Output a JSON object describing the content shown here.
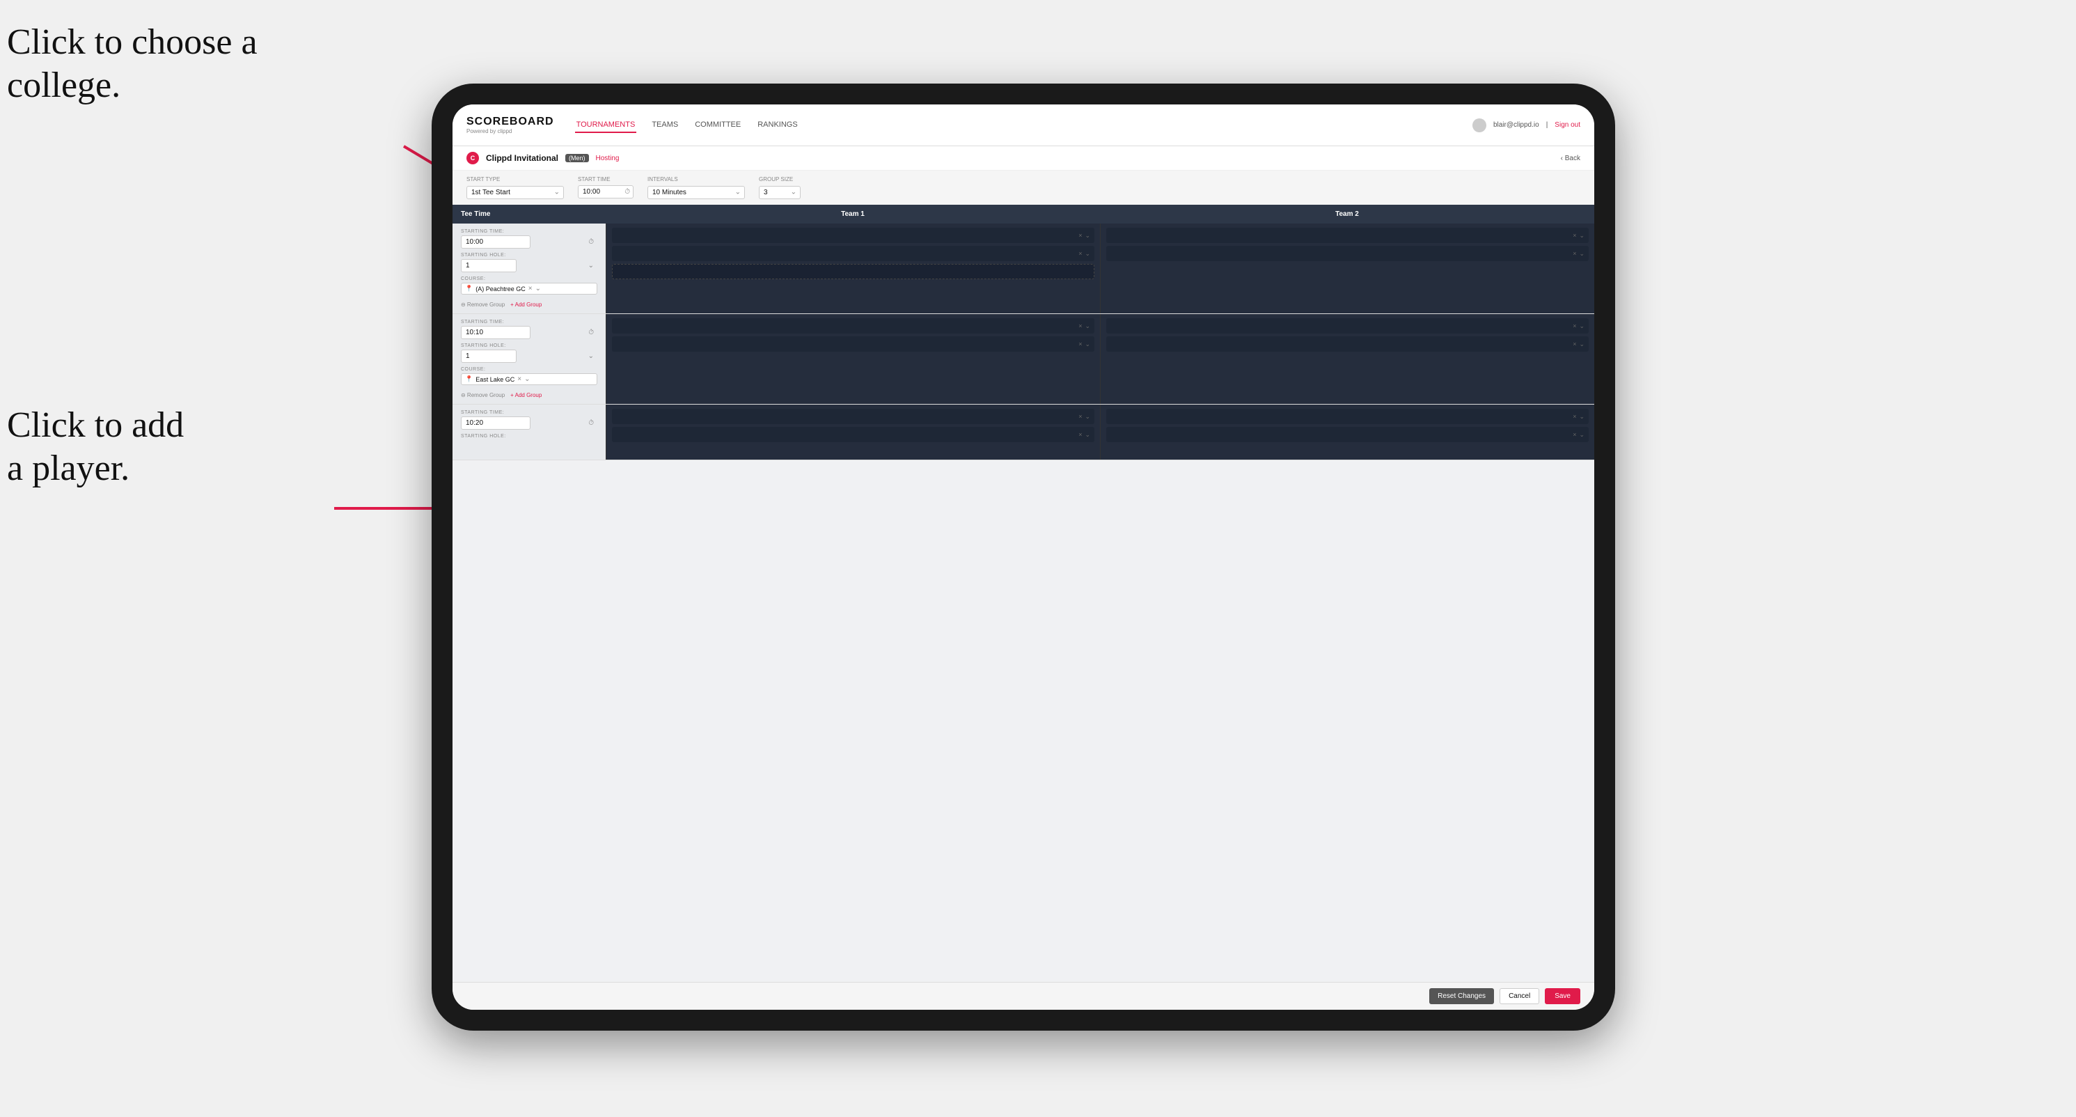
{
  "annotations": {
    "college_text_line1": "Click to choose a",
    "college_text_line2": "college.",
    "player_text_line1": "Click to add",
    "player_text_line2": "a player."
  },
  "nav": {
    "logo_main": "SCOREBOARD",
    "logo_sub": "Powered by clippd",
    "links": [
      "TOURNAMENTS",
      "TEAMS",
      "COMMITTEE",
      "RANKINGS"
    ],
    "active_link": "TOURNAMENTS",
    "user_email": "blair@clippd.io",
    "sign_out": "Sign out"
  },
  "sub_header": {
    "event_name": "Clippd Invitational",
    "gender": "(Men)",
    "status": "Hosting",
    "back_label": "Back"
  },
  "controls": {
    "start_type_label": "Start Type",
    "start_type_value": "1st Tee Start",
    "start_time_label": "Start Time",
    "start_time_value": "10:00",
    "intervals_label": "Intervals",
    "intervals_value": "10 Minutes",
    "group_size_label": "Group Size",
    "group_size_value": "3"
  },
  "table": {
    "col1": "Tee Time",
    "col2": "Team 1",
    "col3": "Team 2"
  },
  "groups": [
    {
      "starting_time": "10:00",
      "starting_hole": "1",
      "course_name": "(A) Peachtree GC",
      "team1_players": 2,
      "team2_players": 2,
      "extra_row": false
    },
    {
      "starting_time": "10:10",
      "starting_hole": "1",
      "course_name": "East Lake GC",
      "team1_players": 2,
      "team2_players": 2,
      "extra_row": false
    },
    {
      "starting_time": "10:20",
      "starting_hole": "",
      "course_name": "",
      "team1_players": 2,
      "team2_players": 2,
      "extra_row": false
    }
  ],
  "footer": {
    "reset_label": "Reset Changes",
    "cancel_label": "Cancel",
    "save_label": "Save"
  }
}
